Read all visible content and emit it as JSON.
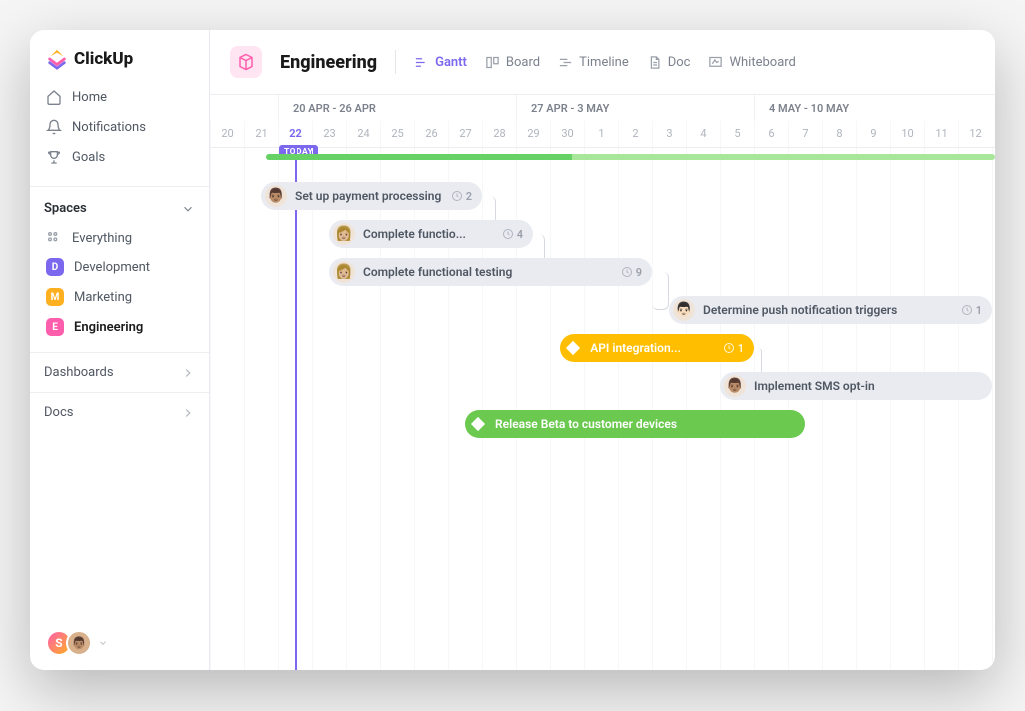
{
  "brand": "ClickUp",
  "nav": {
    "home": "Home",
    "notifications": "Notifications",
    "goals": "Goals"
  },
  "spaces": {
    "header": "Spaces",
    "everything": "Everything",
    "items": [
      {
        "letter": "D",
        "label": "Development",
        "color": "#7b68ee"
      },
      {
        "letter": "M",
        "label": "Marketing",
        "color": "#ffb020"
      },
      {
        "letter": "E",
        "label": "Engineering",
        "color": "#ff5ead"
      }
    ]
  },
  "dashboards_label": "Dashboards",
  "docs_label": "Docs",
  "footer_user_initial": "S",
  "context": {
    "title": "Engineering",
    "badge_bg": "#ffe4f2",
    "badge_fg": "#ff5ead"
  },
  "views": {
    "gantt": "Gantt",
    "board": "Board",
    "timeline": "Timeline",
    "doc": "Doc",
    "whiteboard": "Whiteboard"
  },
  "timeline": {
    "weeks": [
      {
        "label": "20 APR - 26 APR",
        "span": 7,
        "offset": 2
      },
      {
        "label": "27 APR - 3 MAY",
        "span": 7,
        "offset": 9
      },
      {
        "label": "4 MAY - 10 MAY",
        "span": 7,
        "offset": 16
      }
    ],
    "days": [
      "20",
      "21",
      "22",
      "23",
      "24",
      "25",
      "26",
      "27",
      "28",
      "29",
      "30",
      "1",
      "2",
      "3",
      "4",
      "5",
      "6",
      "7",
      "8",
      "9",
      "10",
      "11",
      "12"
    ],
    "today_index": 2,
    "today_label": "TODAY"
  },
  "tasks": [
    {
      "row": 1,
      "start": 1.5,
      "span": 6.5,
      "color": "grey",
      "avatar": "👨🏽",
      "label": "Set up payment processing",
      "count": "2"
    },
    {
      "row": 2,
      "start": 3.5,
      "span": 6,
      "color": "grey",
      "avatar": "👩🏼",
      "label": "Complete functio...",
      "count": "4"
    },
    {
      "row": 3,
      "start": 3.5,
      "span": 9.5,
      "color": "grey",
      "avatar": "👩🏼",
      "label": "Complete functional testing",
      "count": "9"
    },
    {
      "row": 4,
      "start": 13.5,
      "span": 9.5,
      "color": "grey",
      "avatar": "👨🏻",
      "label": "Determine push notification triggers",
      "count": "1"
    },
    {
      "row": 5,
      "start": 10.3,
      "span": 5.7,
      "color": "yellow",
      "diamond": true,
      "label": "API integration...",
      "count": "1"
    },
    {
      "row": 6,
      "start": 15,
      "span": 8,
      "color": "grey",
      "avatar": "👨🏽",
      "label": "Implement SMS opt-in",
      "count": ""
    },
    {
      "row": 7,
      "start": 7.5,
      "span": 10,
      "color": "green",
      "diamond": true,
      "label": "Release Beta to customer devices",
      "count": ""
    }
  ]
}
